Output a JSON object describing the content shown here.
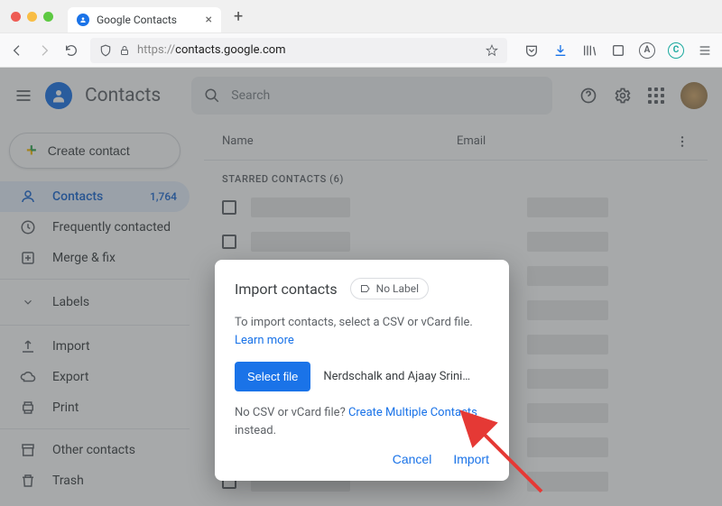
{
  "browser": {
    "tab_title": "Google Contacts",
    "url_display": "https://contacts.google.com",
    "url_host": "contacts.google.com",
    "url_prefix": "https://"
  },
  "header": {
    "app_title": "Contacts",
    "search_placeholder": "Search"
  },
  "sidebar": {
    "create_label": "Create contact",
    "contacts": {
      "label": "Contacts",
      "count": "1,764"
    },
    "frequent": "Frequently contacted",
    "merge": "Merge & fix",
    "labels_heading": "Labels",
    "import": "Import",
    "export": "Export",
    "print": "Print",
    "other": "Other contacts",
    "trash": "Trash"
  },
  "main": {
    "col_name": "Name",
    "col_email": "Email",
    "section_label": "STARRED CONTACTS (6)"
  },
  "dialog": {
    "title": "Import contacts",
    "label_chip": "No Label",
    "desc_pre": "To import contacts, select a CSV or vCard file. ",
    "learn_more": "Learn more",
    "select_file": "Select file",
    "file_name": "Nerdschalk and Ajaay Srini…",
    "nocsv_pre": "No CSV or vCard file? ",
    "nocsv_link": "Create Multiple Contacts",
    "nocsv_post": " instead.",
    "cancel": "Cancel",
    "import": "Import"
  }
}
